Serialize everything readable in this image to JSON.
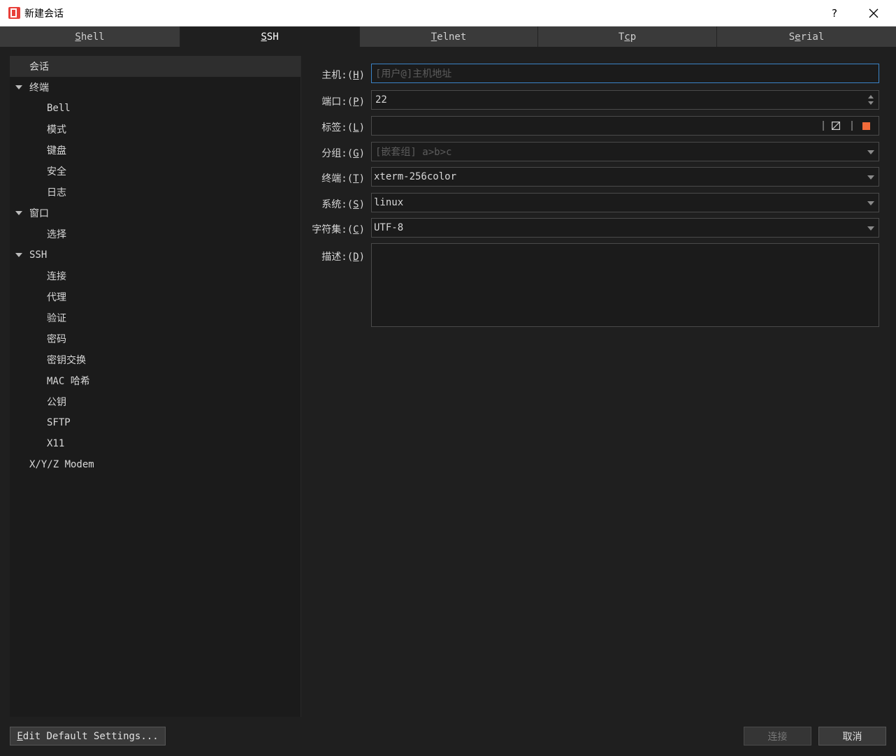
{
  "window": {
    "title": "新建会话",
    "help_label": "?",
    "close_label": "✕"
  },
  "tabs": [
    {
      "label_pre": "",
      "label_u": "S",
      "label_post": "hell",
      "active": false
    },
    {
      "label_pre": "",
      "label_u": "S",
      "label_post": "SH",
      "active": true
    },
    {
      "label_pre": "",
      "label_u": "T",
      "label_post": "elnet",
      "active": false
    },
    {
      "label_pre": "T",
      "label_u": "c",
      "label_post": "p",
      "active": false
    },
    {
      "label_pre": "S",
      "label_u": "e",
      "label_post": "rial",
      "active": false
    }
  ],
  "tree": [
    {
      "label": "会话",
      "level": 0,
      "expandable": false,
      "selected": true
    },
    {
      "label": "终端",
      "level": 0,
      "expandable": true
    },
    {
      "label": "Bell",
      "level": 1
    },
    {
      "label": "模式",
      "level": 1
    },
    {
      "label": "键盘",
      "level": 1
    },
    {
      "label": "安全",
      "level": 1
    },
    {
      "label": "日志",
      "level": 1
    },
    {
      "label": "窗口",
      "level": 0,
      "expandable": true
    },
    {
      "label": "选择",
      "level": 1
    },
    {
      "label": "SSH",
      "level": 0,
      "expandable": true
    },
    {
      "label": "连接",
      "level": 1
    },
    {
      "label": "代理",
      "level": 1
    },
    {
      "label": "验证",
      "level": 1
    },
    {
      "label": "密码",
      "level": 1
    },
    {
      "label": "密钥交换",
      "level": 1
    },
    {
      "label": "MAC 哈希",
      "level": 1
    },
    {
      "label": "公钥",
      "level": 1
    },
    {
      "label": "SFTP",
      "level": 1
    },
    {
      "label": "X11",
      "level": 1
    },
    {
      "label": "X/Y/Z Modem",
      "level": 0,
      "expandable": false
    }
  ],
  "form": {
    "host": {
      "label_pre": "主机:(",
      "label_u": "H",
      "label_post": ")",
      "value": "",
      "placeholder": "[用户@]主机地址"
    },
    "port": {
      "label_pre": "端口:(",
      "label_u": "P",
      "label_post": ")",
      "value": "22"
    },
    "tag": {
      "label_pre": "标签:(",
      "label_u": "L",
      "label_post": ")",
      "value": "",
      "color": "#f26b3a"
    },
    "group": {
      "label_pre": "分组:(",
      "label_u": "G",
      "label_post": ")",
      "value": "",
      "placeholder": "[嵌套组] a>b>c"
    },
    "terminal": {
      "label_pre": "终端:(",
      "label_u": "T",
      "label_post": ")",
      "value": "xterm-256color"
    },
    "system": {
      "label_pre": "系统:(",
      "label_u": "S",
      "label_post": ")",
      "value": "linux"
    },
    "charset": {
      "label_pre": "字符集:(",
      "label_u": "C",
      "label_post": ")",
      "value": "UTF-8"
    },
    "description": {
      "label_pre": "描述:(",
      "label_u": "D",
      "label_post": ")",
      "value": ""
    }
  },
  "buttons": {
    "edit_defaults_u": "E",
    "edit_defaults_rest": "dit Default Settings...",
    "connect": "连接",
    "cancel": "取消"
  },
  "colors": {
    "background": "#1f1f1f",
    "focus_border": "#3a83c7",
    "app_icon": "#e8403a"
  }
}
